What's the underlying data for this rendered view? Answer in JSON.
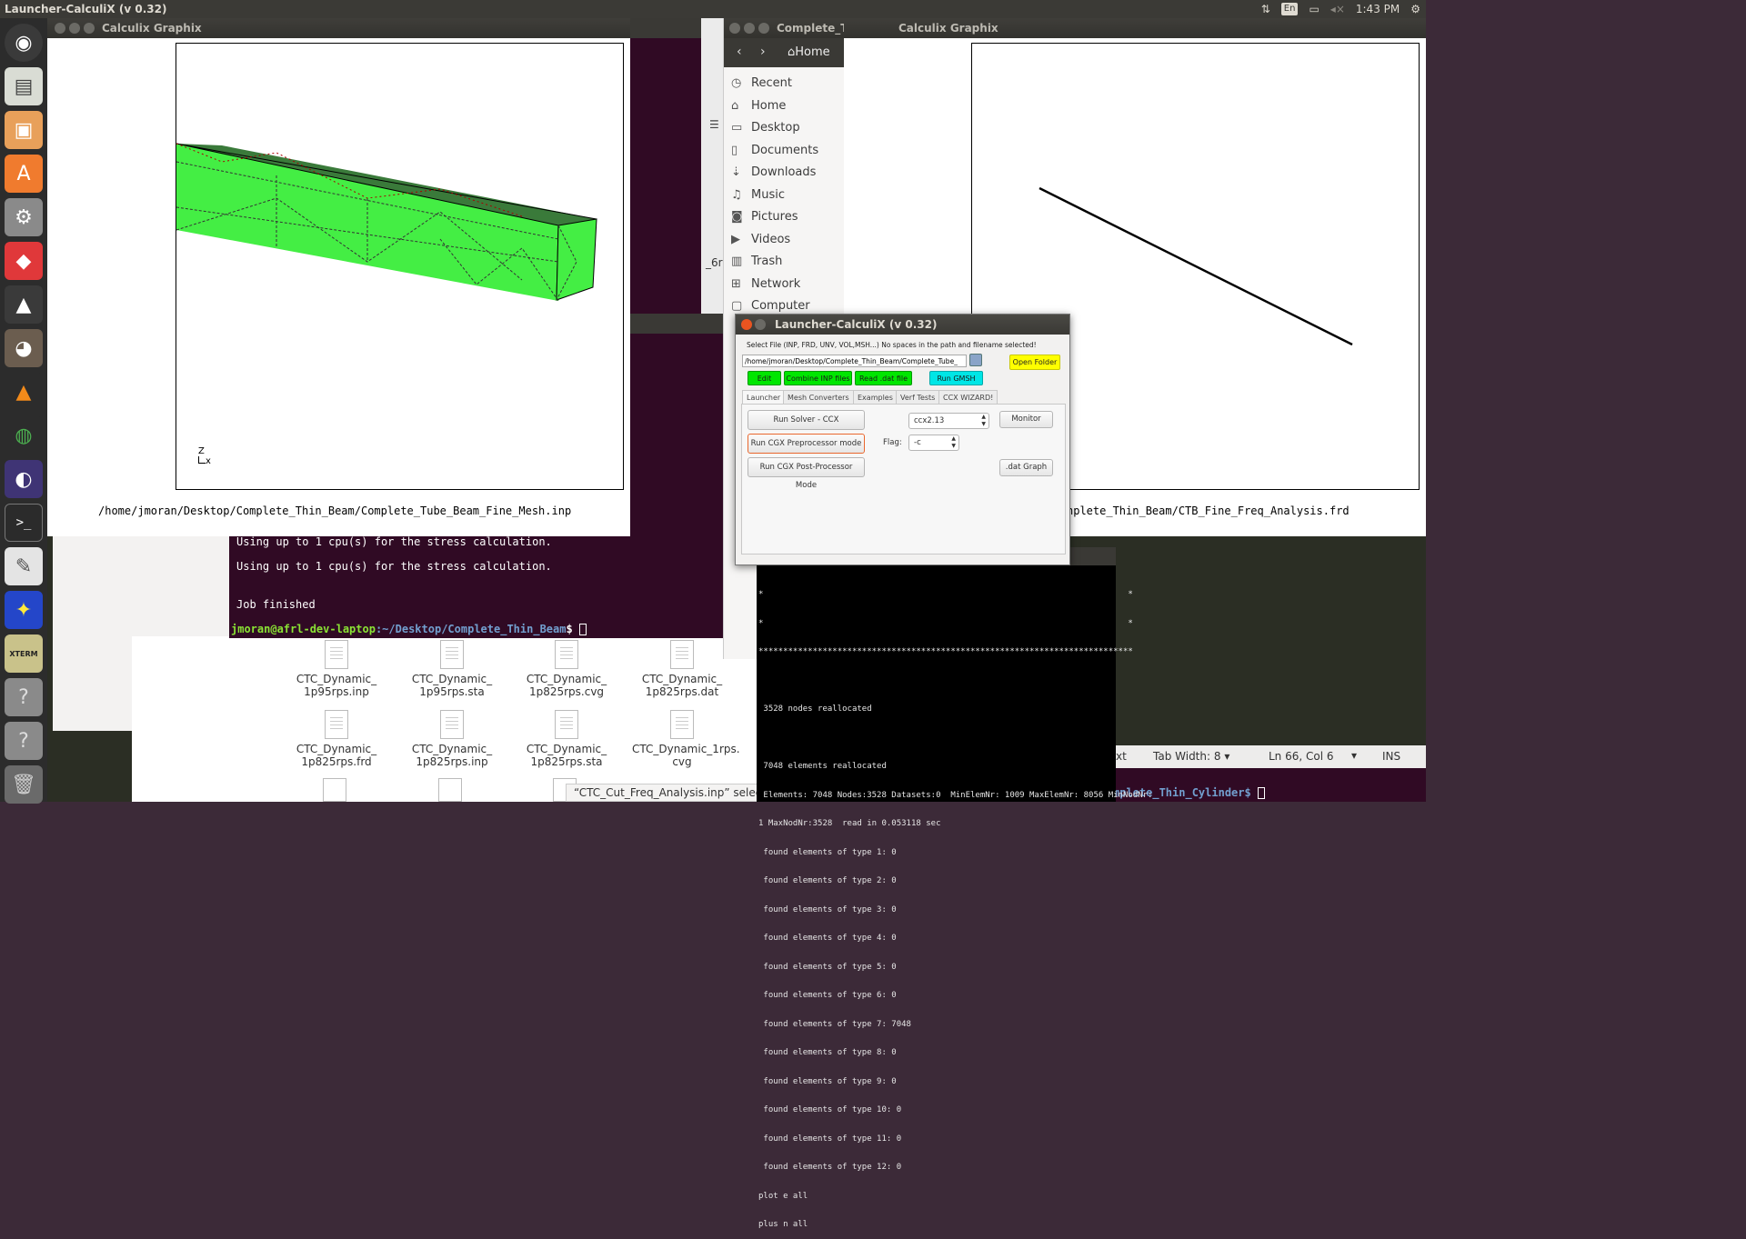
{
  "top_panel": {
    "title": "Launcher-CalculiX (v 0.32)",
    "keyboard": "En",
    "time": "1:43 PM"
  },
  "launcher_icons": [
    "ubuntu-dash-icon",
    "files-icon",
    "impress-icon",
    "software-center-icon",
    "settings-icon",
    "git-icon",
    "inkscape-icon",
    "gimp-icon",
    "vlc-icon",
    "chrome-icon",
    "eclipse-icon",
    "terminal-icon",
    "text-editor-icon",
    "star-icon",
    "xterm-icon",
    "help-icon",
    "help-icon-2",
    "trash-icon"
  ],
  "xterm_label": "XTERM",
  "left_graphix": {
    "title": "Calculix Graphix",
    "axis_label_z": "Z",
    "axis_label_yx": "Ly",
    "axis_label_x": "x",
    "filepath": "/home/jmoran/Desktop/Complete_Thin_Beam/Complete_Tube_Beam_Fine_Mesh.inp"
  },
  "right_graphix": {
    "title": "Calculix Graphix",
    "filepath": "nplete_Thin_Beam/CTB_Fine_Freq_Analysis.frd"
  },
  "file_manager": {
    "title": "Complete_Tl",
    "home_button": "Home",
    "sidebar": [
      "Recent",
      "Home",
      "Desktop",
      "Documents",
      "Downloads",
      "Music",
      "Pictures",
      "Videos",
      "Trash",
      "Network",
      "Computer"
    ],
    "partial_text": "_6rp"
  },
  "terminal": {
    "lines": [
      "Using up to 1 cpu(s) for the stress calculation.",
      "Using up to 1 cpu(s) for the stress calculation.",
      "Job finished"
    ],
    "prompt_user": "jmoran@afrl-dev-laptop",
    "prompt_path": ":~/Desktop/Complete_Thin_Beam",
    "prompt_end": "$ "
  },
  "files": [
    {
      "name1": "CTC_Dynamic_",
      "name2": "1p95rps.inp"
    },
    {
      "name1": "CTC_Dynamic_",
      "name2": "1p95rps.sta"
    },
    {
      "name1": "CTC_Dynamic_",
      "name2": "1p825rps.cvg"
    },
    {
      "name1": "CTC_Dynamic_",
      "name2": "1p825rps.dat"
    },
    {
      "name1": "CTC_Dynamic_",
      "name2": "1p825rps.frd"
    },
    {
      "name1": "CTC_Dynamic_",
      "name2": "1p825rps.inp"
    },
    {
      "name1": "CTC_Dynamic_",
      "name2": "1p825rps.sta"
    },
    {
      "name1": "CTC_Dynamic_1rps.",
      "name2": "cvg"
    }
  ],
  "selection_status": "“CTC_Cut_Freq_Analysis.inp” selecte",
  "editor_status": {
    "partial": "xt",
    "tab_width": "Tab Width: 8",
    "position": "Ln 66, Col 6",
    "mode": "INS"
  },
  "bottom_prompt": "mplete_Thin_Cylinder$ ",
  "cgx_terminal": {
    "lines": [
      "*                                                                          *",
      "*                                                                          *",
      "****************************************************************************",
      "",
      " 3528 nodes reallocated",
      "",
      " 7048 elements reallocated",
      " Elements: 7048 Nodes:3528 Datasets:0  MinElemNr: 1009 MaxElemNr: 8056 MinNodNr:",
      "1 MaxNodNr:3528  read in 0.053118 sec",
      " found elements of type 1: 0",
      " found elements of type 2: 0",
      " found elements of type 3: 0",
      " found elements of type 4: 0",
      " found elements of type 5: 0",
      " found elements of type 6: 0",
      " found elements of type 7: 7048",
      " found elements of type 8: 0",
      " found elements of type 9: 0",
      " found elements of type 10: 0",
      " found elements of type 11: 0",
      " found elements of type 12: 0",
      "plot e all",
      "plus n all"
    ]
  },
  "launcher_dialog": {
    "title": "Launcher-CalculiX (v 0.32)",
    "instruction": "Select File (INP, FRD, UNV, VOL,MSH...) No spaces in the path and filename selected!",
    "path_value": "/home/jmoran/Desktop/Complete_Thin_Beam/Complete_Tube_",
    "open_folder": "Open Folder",
    "edit": "Edit",
    "combine": "Combine INP files",
    "read_dat": "Read .dat file",
    "run_gmsh": "Run GMSH",
    "tabs": [
      "Launcher",
      "Mesh Converters",
      "Examples",
      "Verf Tests",
      "CCX WIZARD!"
    ],
    "run_solver": "Run Solver - CCX",
    "run_cgx_pre": "Run CGX Preprocessor mode",
    "run_cgx_post": "Run CGX Post-Processor Mode",
    "solver_select": "ccx2.13",
    "monitor": "Monitor",
    "flag_label": "Flag:",
    "flag_value": "-c",
    "dat_graph": ".dat Graph"
  }
}
